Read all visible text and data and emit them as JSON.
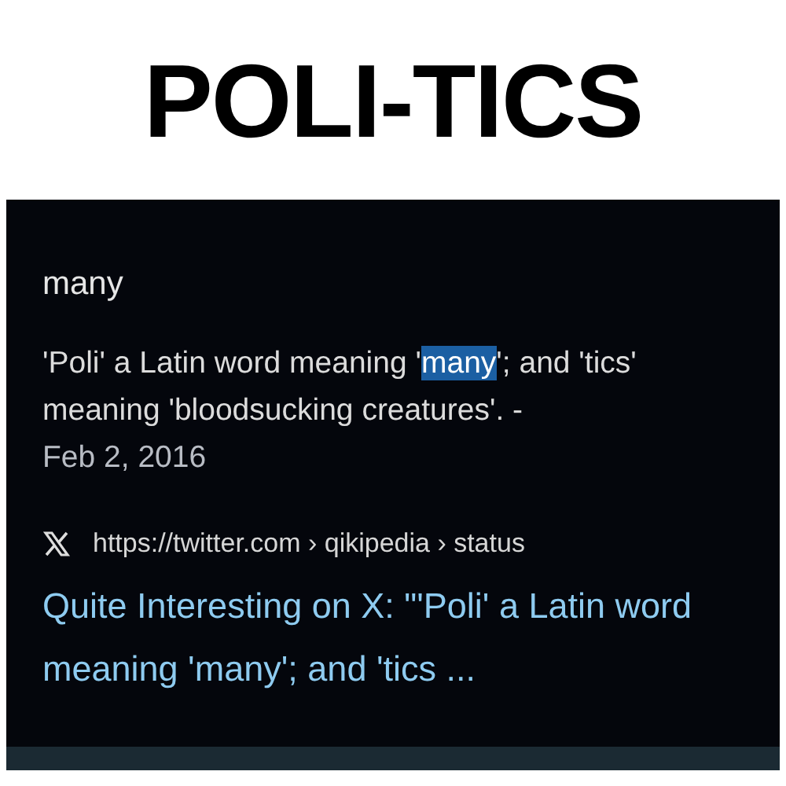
{
  "caption": "POLI-TICS",
  "result": {
    "heading": "many",
    "snippet_parts": [
      {
        "text": "'Poli' a Latin word meaning '",
        "selected": false
      },
      {
        "text": "many",
        "selected": true
      },
      {
        "text": "'; and 'tics' meaning 'bloodsucking creatures'. -",
        "selected": false
      }
    ],
    "date": "Feb 2, 2016",
    "source_url": "https://twitter.com › qikipedia › status",
    "link_title": "Quite Interesting on X: \"'Poli' a Latin word meaning 'many'; and 'tics ..."
  }
}
